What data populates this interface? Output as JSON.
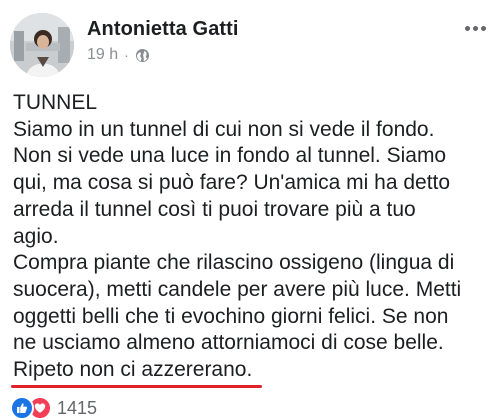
{
  "post": {
    "author": "Antonietta Gatti",
    "time": "19 h",
    "separator": "·",
    "privacy_icon": "globe-icon",
    "more_icon": "more-options-icon",
    "text_lines": [
      "TUNNEL",
      "Siamo in un tunnel di cui non si vede il fondo.",
      "Non si vede una luce in fondo al tunnel. Siamo",
      "qui, ma cosa si può fare? Un'amica mi ha detto",
      "arreda il tunnel così ti puoi trovare più a tuo",
      "agio.",
      "Compra piante che rilascino ossigeno (lingua di",
      "suocera), metti candele per avere più luce. Metti",
      "oggetti belli che ti evochino giorni felici. Se non",
      "ne usciamo almeno attorniamoci di cose belle."
    ],
    "underlined_line": "Ripeto non ci azzererano.",
    "underline_color": "#e0202a"
  },
  "reactions": {
    "icons": [
      "like-icon",
      "love-icon"
    ],
    "count": "1415"
  },
  "colors": {
    "like": "#1b74e4",
    "love": "#f33e58",
    "meta": "#8a8d91"
  }
}
